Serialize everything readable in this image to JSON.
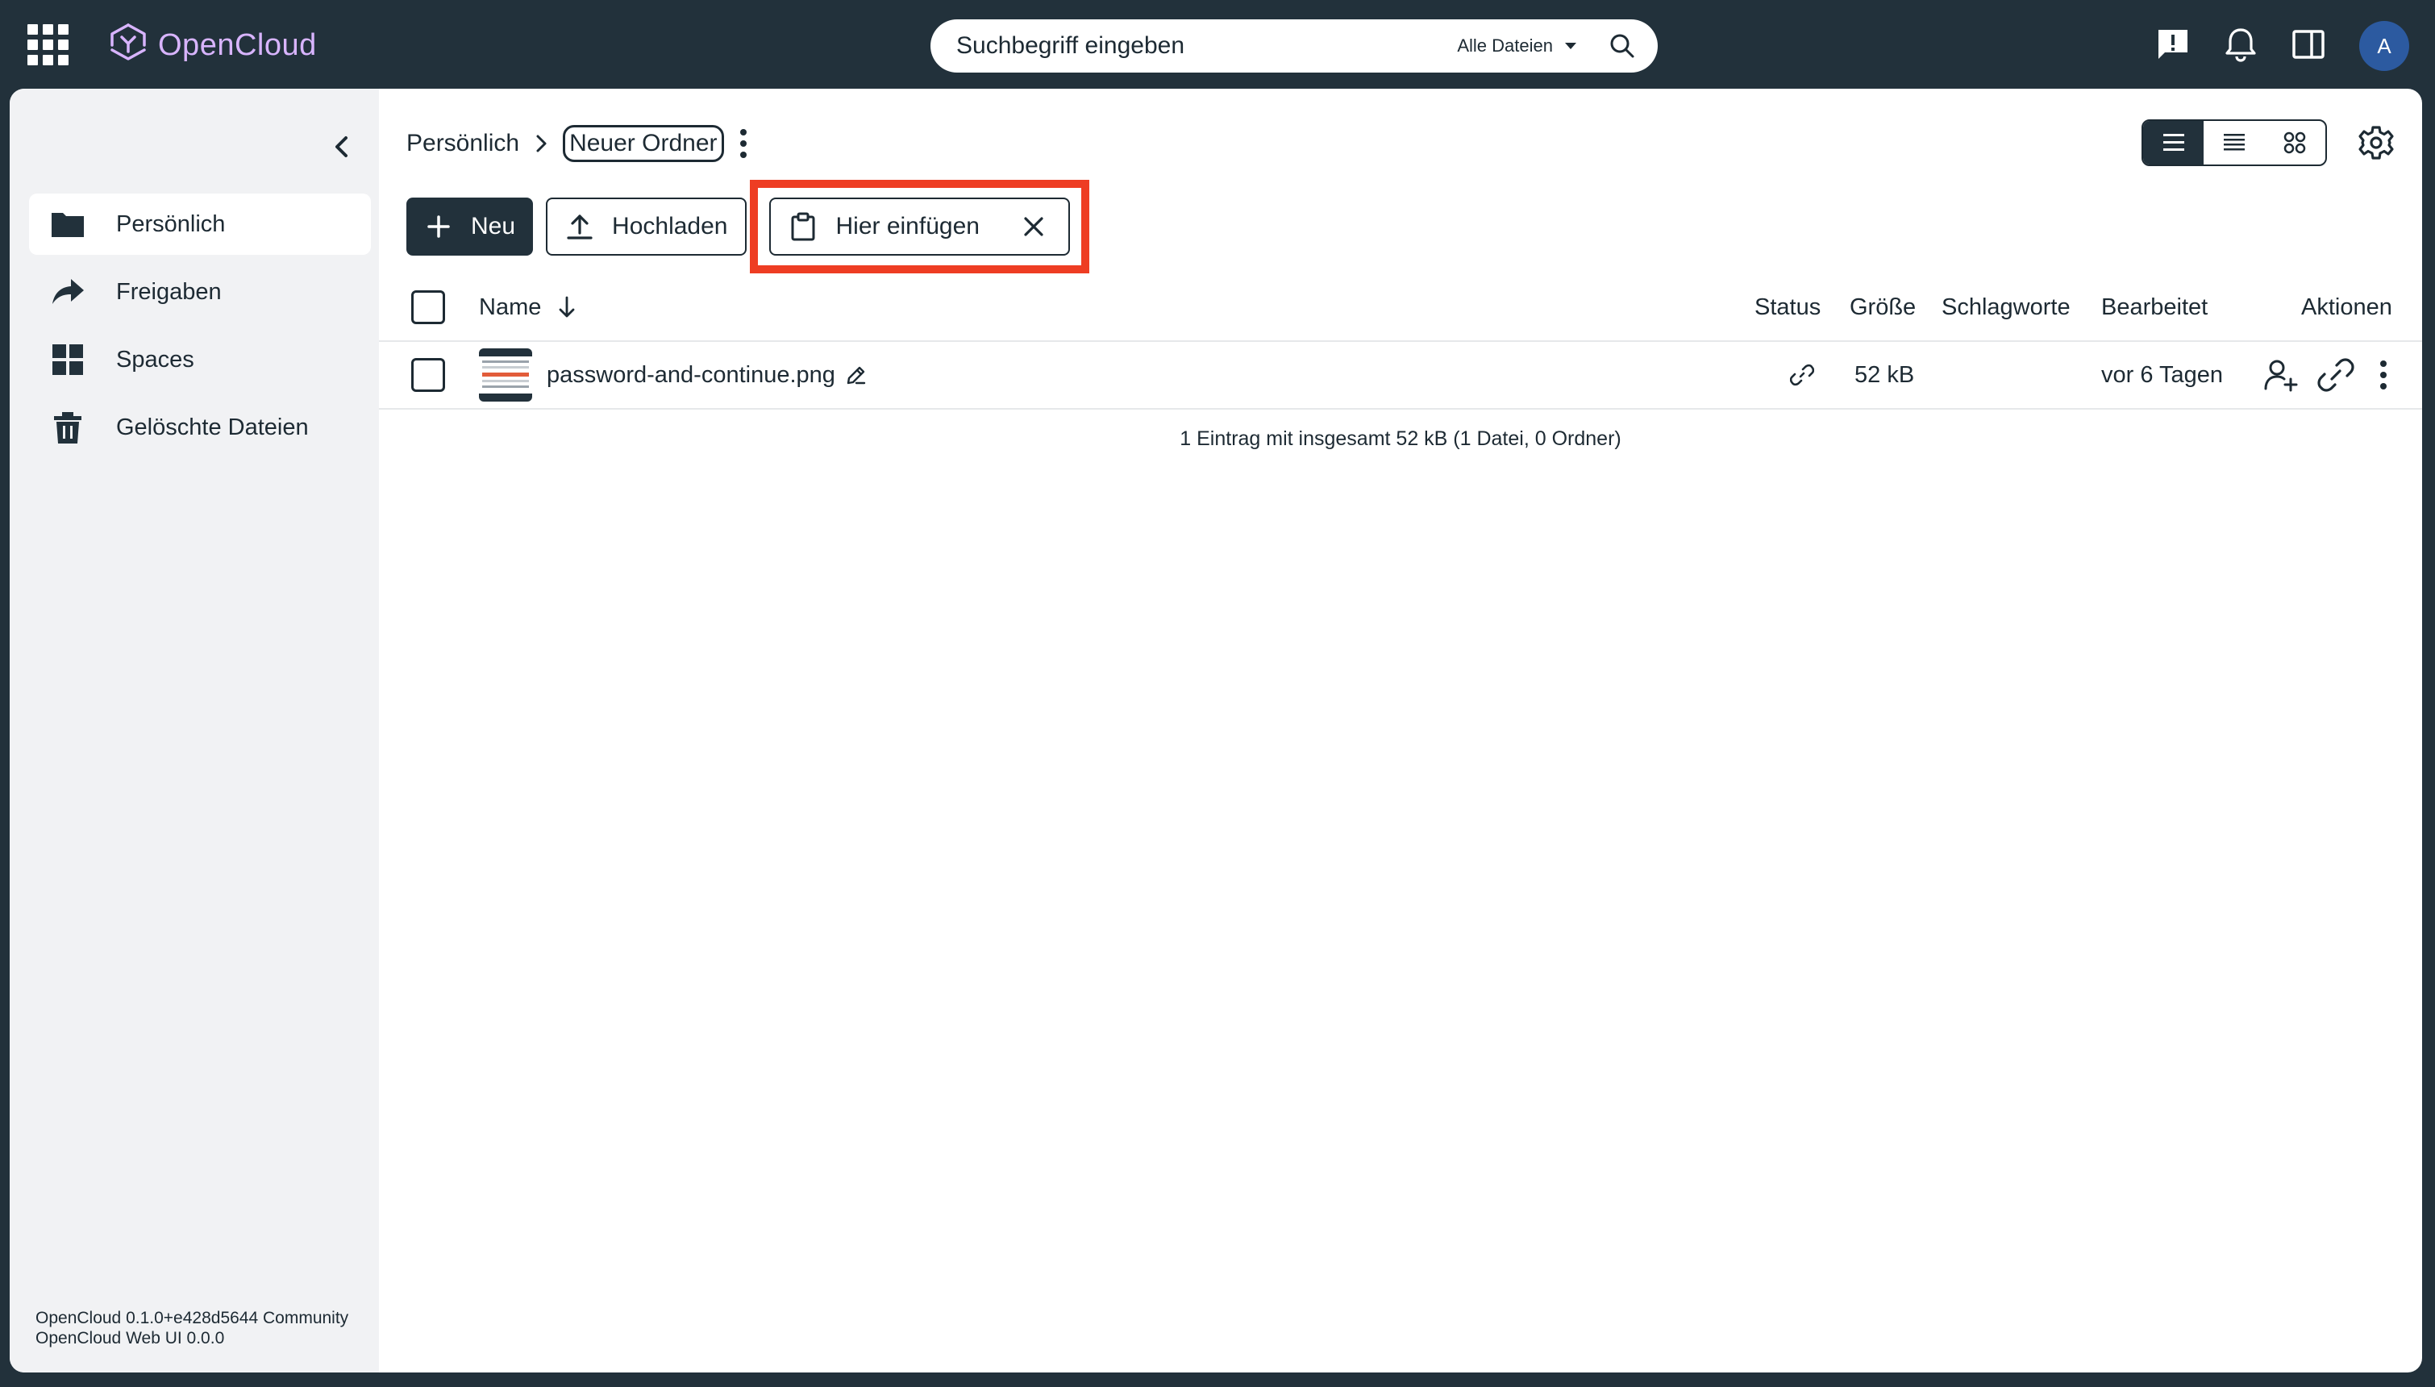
{
  "header": {
    "app_name": "OpenCloud",
    "search": {
      "placeholder": "Suchbegriff eingeben",
      "scope": "Alle Dateien"
    },
    "avatar_initial": "A"
  },
  "sidebar": {
    "items": [
      {
        "label": "Persönlich",
        "icon": "folder-icon",
        "active": true
      },
      {
        "label": "Freigaben",
        "icon": "share-icon",
        "active": false
      },
      {
        "label": "Spaces",
        "icon": "grid-icon",
        "active": false
      },
      {
        "label": "Gelöschte Dateien",
        "icon": "trash-icon",
        "active": false
      }
    ],
    "version_line1": "OpenCloud 0.1.0+e428d5644 Community",
    "version_line2": "OpenCloud Web UI 0.0.0"
  },
  "breadcrumb": {
    "root": "Persönlich",
    "current": "Neuer Ordner"
  },
  "toolbar": {
    "new_label": "Neu",
    "upload_label": "Hochladen",
    "paste_label": "Hier einfügen"
  },
  "table": {
    "columns": {
      "name": "Name",
      "status": "Status",
      "size": "Größe",
      "tags": "Schlagworte",
      "modified": "Bearbeitet",
      "actions": "Aktionen"
    },
    "rows": [
      {
        "name": "password-and-continue.png",
        "size": "52 kB",
        "tags": "",
        "modified": "vor 6 Tagen"
      }
    ],
    "summary": "1 Eintrag mit insgesamt 52 kB (1 Datei, 0 Ordner)"
  },
  "colors": {
    "topbar_bg": "#22313b",
    "logo": "#d8b4fe",
    "primary": "#22313b",
    "highlight": "#ee3d23",
    "avatar": "#2c5aa0"
  }
}
